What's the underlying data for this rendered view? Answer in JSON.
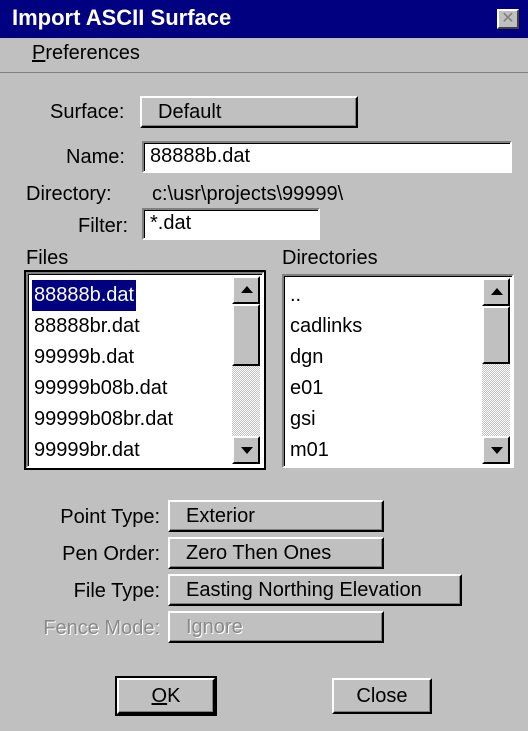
{
  "window": {
    "title": "Import ASCII Surface",
    "close_glyph": "✕"
  },
  "menu": {
    "preferences_accel": "P",
    "preferences_rest": "references"
  },
  "surface": {
    "label": "Surface:",
    "value": "Default"
  },
  "name": {
    "label": "Name:",
    "value": "88888b.dat"
  },
  "directory": {
    "label": "Directory:",
    "value": "c:\\usr\\projects\\99999\\"
  },
  "filter": {
    "label": "Filter:",
    "value": "*.dat"
  },
  "files": {
    "label": "Files",
    "items": [
      "88888b.dat",
      "88888br.dat",
      "99999b.dat",
      "99999b08b.dat",
      "99999b08br.dat",
      "99999br.dat"
    ],
    "selected_index": 0
  },
  "directories": {
    "label": "Directories",
    "items": [
      "..",
      "cadlinks",
      "dgn",
      "e01",
      "gsi",
      "m01"
    ]
  },
  "point_type": {
    "label": "Point Type:",
    "value": "Exterior"
  },
  "pen_order": {
    "label": "Pen Order:",
    "value": "Zero Then Ones"
  },
  "file_type": {
    "label": "File Type:",
    "value": "Easting Northing Elevation"
  },
  "fence_mode": {
    "label": "Fence Mode:",
    "value": "Ignore",
    "disabled": true
  },
  "buttons": {
    "ok_accel": "O",
    "ok_rest": "K",
    "close": "Close"
  },
  "icons": {
    "close": "close-icon",
    "scroll_up": "arrow-up-icon",
    "scroll_down": "arrow-down-icon"
  },
  "colors": {
    "titlebar": "#000080",
    "face": "#c0c0c0",
    "selection": "#000080"
  }
}
